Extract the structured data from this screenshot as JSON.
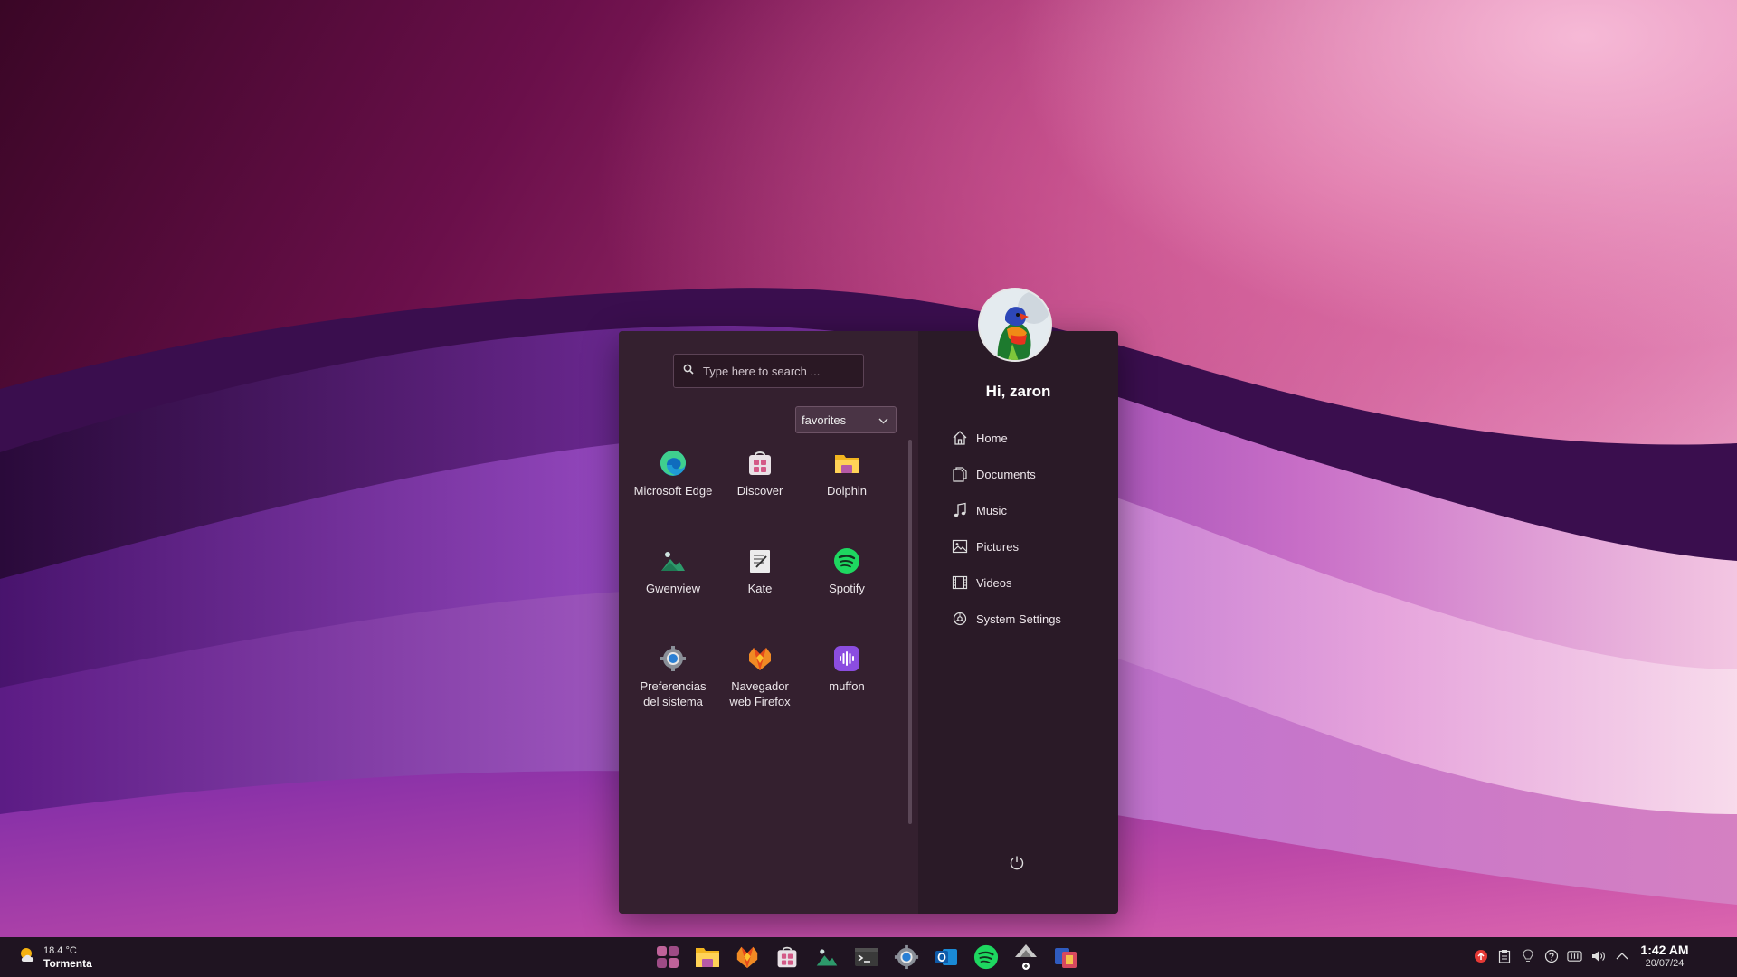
{
  "search": {
    "placeholder": "Type here to search ..."
  },
  "category": {
    "selected": "favorites"
  },
  "apps": [
    {
      "label": "Microsoft Edge",
      "icon": "edge-icon"
    },
    {
      "label": "Discover",
      "icon": "discover-icon"
    },
    {
      "label": "Dolphin",
      "icon": "folder-icon"
    },
    {
      "label": "Gwenview",
      "icon": "image-viewer-icon"
    },
    {
      "label": "Kate",
      "icon": "text-editor-icon"
    },
    {
      "label": "Spotify",
      "icon": "spotify-icon"
    },
    {
      "label": "Preferencias del sistema",
      "icon": "system-settings-icon"
    },
    {
      "label": "Navegador web Firefox",
      "icon": "firefox-icon"
    },
    {
      "label": "muffon",
      "icon": "muffon-icon"
    }
  ],
  "user": {
    "greeting": "Hi, zaron"
  },
  "places": [
    {
      "label": "Home",
      "icon": "home-icon"
    },
    {
      "label": "Documents",
      "icon": "documents-icon"
    },
    {
      "label": "Music",
      "icon": "music-icon"
    },
    {
      "label": "Pictures",
      "icon": "pictures-icon"
    },
    {
      "label": "Videos",
      "icon": "videos-icon"
    },
    {
      "label": "System Settings",
      "icon": "settings-icon"
    }
  ],
  "weather": {
    "temperature": "18.4 °C",
    "condition": "Tormenta"
  },
  "taskbar": {
    "apps": [
      "start-menu-icon",
      "dolphin-icon",
      "firefox-icon",
      "discover-icon",
      "gwenview-icon",
      "terminal-icon",
      "system-settings-icon",
      "outlook-icon",
      "spotify-icon",
      "plasma-vault-icon",
      "app-icon"
    ]
  },
  "clock": {
    "time": "1:42 AM",
    "date": "20/07/24"
  },
  "colors": {
    "accent": "#b03a82",
    "panel": "#35202f",
    "taskbar": "#1f1421"
  }
}
